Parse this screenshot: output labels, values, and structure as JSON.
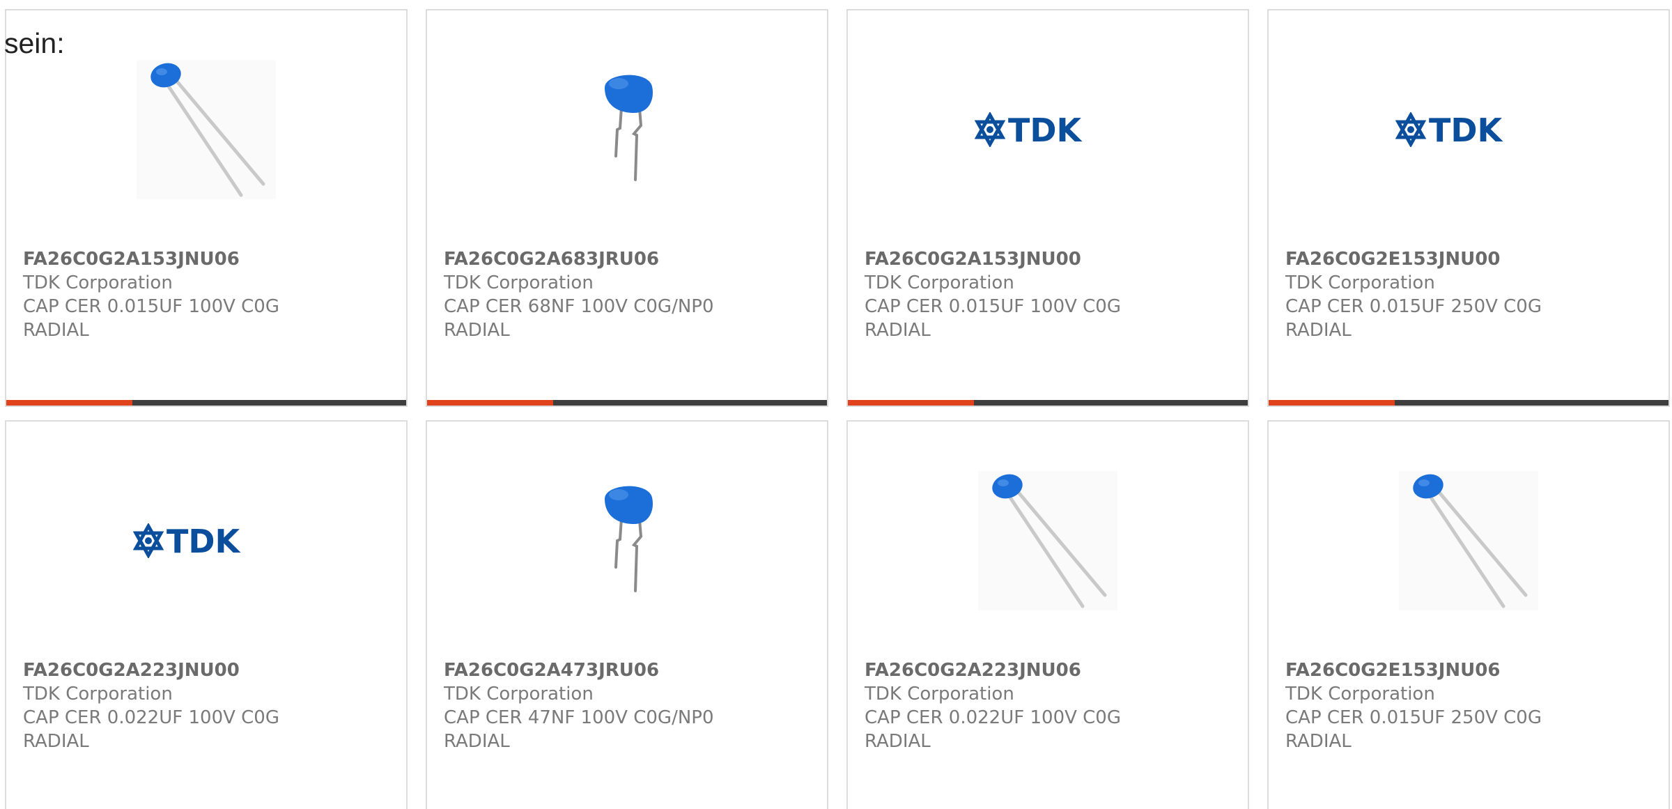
{
  "intro_text": "sein:",
  "colors": {
    "accent": "#e0421c",
    "bar_dark": "#3e3e3e",
    "capacitor_blue": "#1c6ed8",
    "tdk_blue": "#0b4f9c"
  },
  "products": [
    {
      "part": "FA26C0G2A153JNU06",
      "maker": "TDK Corporation",
      "desc_line1": "CAP CER 0.015UF 100V C0G",
      "desc_line2": "RADIAL",
      "image": "small-capacitor"
    },
    {
      "part": "FA26C0G2A683JRU06",
      "maker": "TDK Corporation",
      "desc_line1": "CAP CER 68NF 100V C0G/NP0",
      "desc_line2": "RADIAL",
      "image": "large-capacitor"
    },
    {
      "part": "FA26C0G2A153JNU00",
      "maker": "TDK Corporation",
      "desc_line1": "CAP CER 0.015UF 100V C0G",
      "desc_line2": "RADIAL",
      "image": "tdk-logo",
      "logo_text": "TDK"
    },
    {
      "part": "FA26C0G2E153JNU00",
      "maker": "TDK Corporation",
      "desc_line1": "CAP CER 0.015UF 250V C0G",
      "desc_line2": "RADIAL",
      "image": "tdk-logo",
      "logo_text": "TDK"
    },
    {
      "part": "FA26C0G2A223JNU00",
      "maker": "TDK Corporation",
      "desc_line1": "CAP CER 0.022UF 100V C0G",
      "desc_line2": "RADIAL",
      "image": "tdk-logo",
      "logo_text": "TDK"
    },
    {
      "part": "FA26C0G2A473JRU06",
      "maker": "TDK Corporation",
      "desc_line1": "CAP CER 47NF 100V C0G/NP0",
      "desc_line2": "RADIAL",
      "image": "large-capacitor"
    },
    {
      "part": "FA26C0G2A223JNU06",
      "maker": "TDK Corporation",
      "desc_line1": "CAP CER 0.022UF 100V C0G",
      "desc_line2": "RADIAL",
      "image": "small-capacitor"
    },
    {
      "part": "FA26C0G2E153JNU06",
      "maker": "TDK Corporation",
      "desc_line1": "CAP CER 0.015UF 250V C0G",
      "desc_line2": "RADIAL",
      "image": "small-capacitor"
    }
  ]
}
